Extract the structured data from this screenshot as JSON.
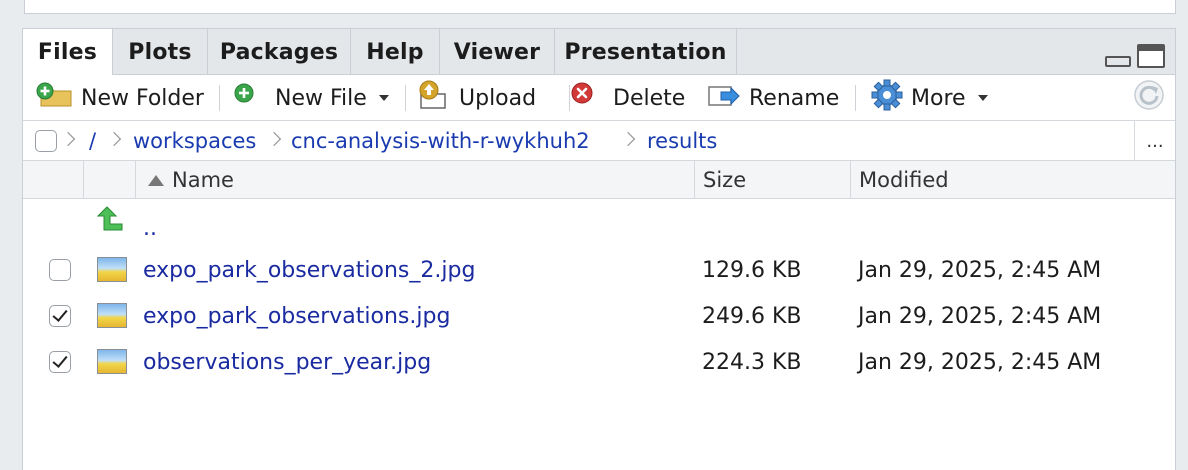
{
  "tabs": [
    "Files",
    "Plots",
    "Packages",
    "Help",
    "Viewer",
    "Presentation"
  ],
  "toolbar": {
    "new_folder": "New Folder",
    "new_file": "New File",
    "upload": "Upload",
    "delete": "Delete",
    "rename": "Rename",
    "more": "More"
  },
  "breadcrumb": {
    "root": "/",
    "items": [
      "workspaces",
      "cnc-analysis-with-r-wykhuh2",
      "results"
    ],
    "more": "..."
  },
  "columns": {
    "name": "Name",
    "size": "Size",
    "modified": "Modified"
  },
  "parent_dir": "..",
  "files": [
    {
      "name": "expo_park_observations_2.jpg",
      "size": "129.6 KB",
      "modified": "Jan 29, 2025, 2:45 AM",
      "checked": false
    },
    {
      "name": "expo_park_observations.jpg",
      "size": "249.6 KB",
      "modified": "Jan 29, 2025, 2:45 AM",
      "checked": true
    },
    {
      "name": "observations_per_year.jpg",
      "size": "224.3 KB",
      "modified": "Jan 29, 2025, 2:45 AM",
      "checked": true
    }
  ],
  "colors": {
    "link": "#1a3bb0",
    "active_tab": "#ffffff",
    "tabbar": "#e4e7ea"
  }
}
